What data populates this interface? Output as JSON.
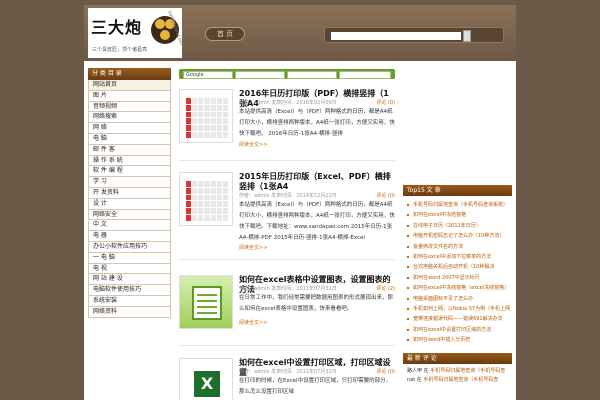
{
  "header": {
    "logo_text": "三大炮",
    "logo_sub": "三个臭皮匠，顶个诸葛亮",
    "logo_url": "sandapao.com",
    "home_label": "首 页"
  },
  "tabs": [
    "Google",
    "",
    "",
    ""
  ],
  "left_sidebar": {
    "title": "分 类 目 录",
    "items": [
      "网站首页",
      "图 片",
      "音频视频",
      "网络搜索",
      "网 络",
      "电 脑",
      "邮 件 客",
      "操 作 系 统",
      "软 件 编 程",
      "学 习",
      "开 发资料",
      "设 计",
      "网络安全",
      "中 文",
      "电 器",
      "办公小软件应用技巧",
      "一 电 脑",
      "电 视",
      "网 站 建 设",
      "电脑软件使用技巧",
      "系统安装",
      "网络资料"
    ]
  },
  "posts": [
    {
      "title": "2016年日历打印版（PDF）横排竖排（1张A4",
      "meta": "作者：admin  发表时间：2016年02月09日",
      "count": "评论 (0)",
      "body": "本站提供高清（Excel）与（PDF）两种格式的日历，都是A4纸打印大小，横排竖排两种版本，A4纸一张打印，方便又实用，快快下载吧。 2016年日历-1张A4-横排-竖排",
      "more": "阅读全文>>"
    },
    {
      "title": "2015年日历打印版（Excel、PDF）横排竖排（1张A4",
      "meta": "作者：admin  发表时间：2014年12月21日",
      "count": "评论 (0)",
      "body": "本站提供高清（Excel）与（PDF）两种格式的日历，都是A4纸打印大小，横排竖排两种版本，A4纸一张打印，方便又实用，快快下载吧。下载地址：www.sandapao.com 2015年日历-1张A4-横排-PDF 2015年日历-竖排-1张A4-横排-Excel",
      "more": "阅读全文>>"
    },
    {
      "title": "如何在excel表格中设置图表，设置图表的方法",
      "meta": "作者：admin  发表时间：2011年07月31日",
      "count": "评论 (2)",
      "body": "在日常工作中，我们经常需要把数据用图表的形式展现出来，那么如何在excel表格中设置图表，快来看看吧。",
      "more": "阅读全文>>"
    },
    {
      "title": "如何在excel中设置打印区域，打印区域设置",
      "meta": "作者：admin  发表时间：2011年07月31日",
      "count": "评论 (0)",
      "body": "在打印的时候，在Excel中设置打印区域，只打印需要的部分，那么怎么设置打印区域",
      "more": ""
    }
  ],
  "right_sidebar": {
    "top_title": "Top15 文 章",
    "top_items": [
      "手机号码归属地查询（手机号码查询系统）",
      "如何在excel中冻结窗格",
      "在线电子日历（2011年日历）",
      "电脑开机密码忘记了怎么办（10种方法）",
      "批量修改文件名的方法",
      "如何在excel中添加下拉菜单的方法",
      "台式电脑关机后自动开机（10种解决",
      "如何在word 2007中显示标尺",
      "如何在excel中冻结窗格（excel冻结窗格）",
      "电脑桌面图标不见了怎么办",
      "手机如何上网，以Nokia S7为例（手机上网",
      "宽带连接错误代码——错误691解决办法",
      "如何在excel中设置打印区域的方法",
      "如何在word中插入分页符"
    ],
    "recent_title": "最 新 评 论",
    "recent_lines": [
      {
        "who": "路人甲 在",
        "link": "手机号码归属地查询（手机号码查"
      },
      {
        "who": "nat 在",
        "link": "手机号码归属地查询（手机号码查"
      }
    ]
  }
}
